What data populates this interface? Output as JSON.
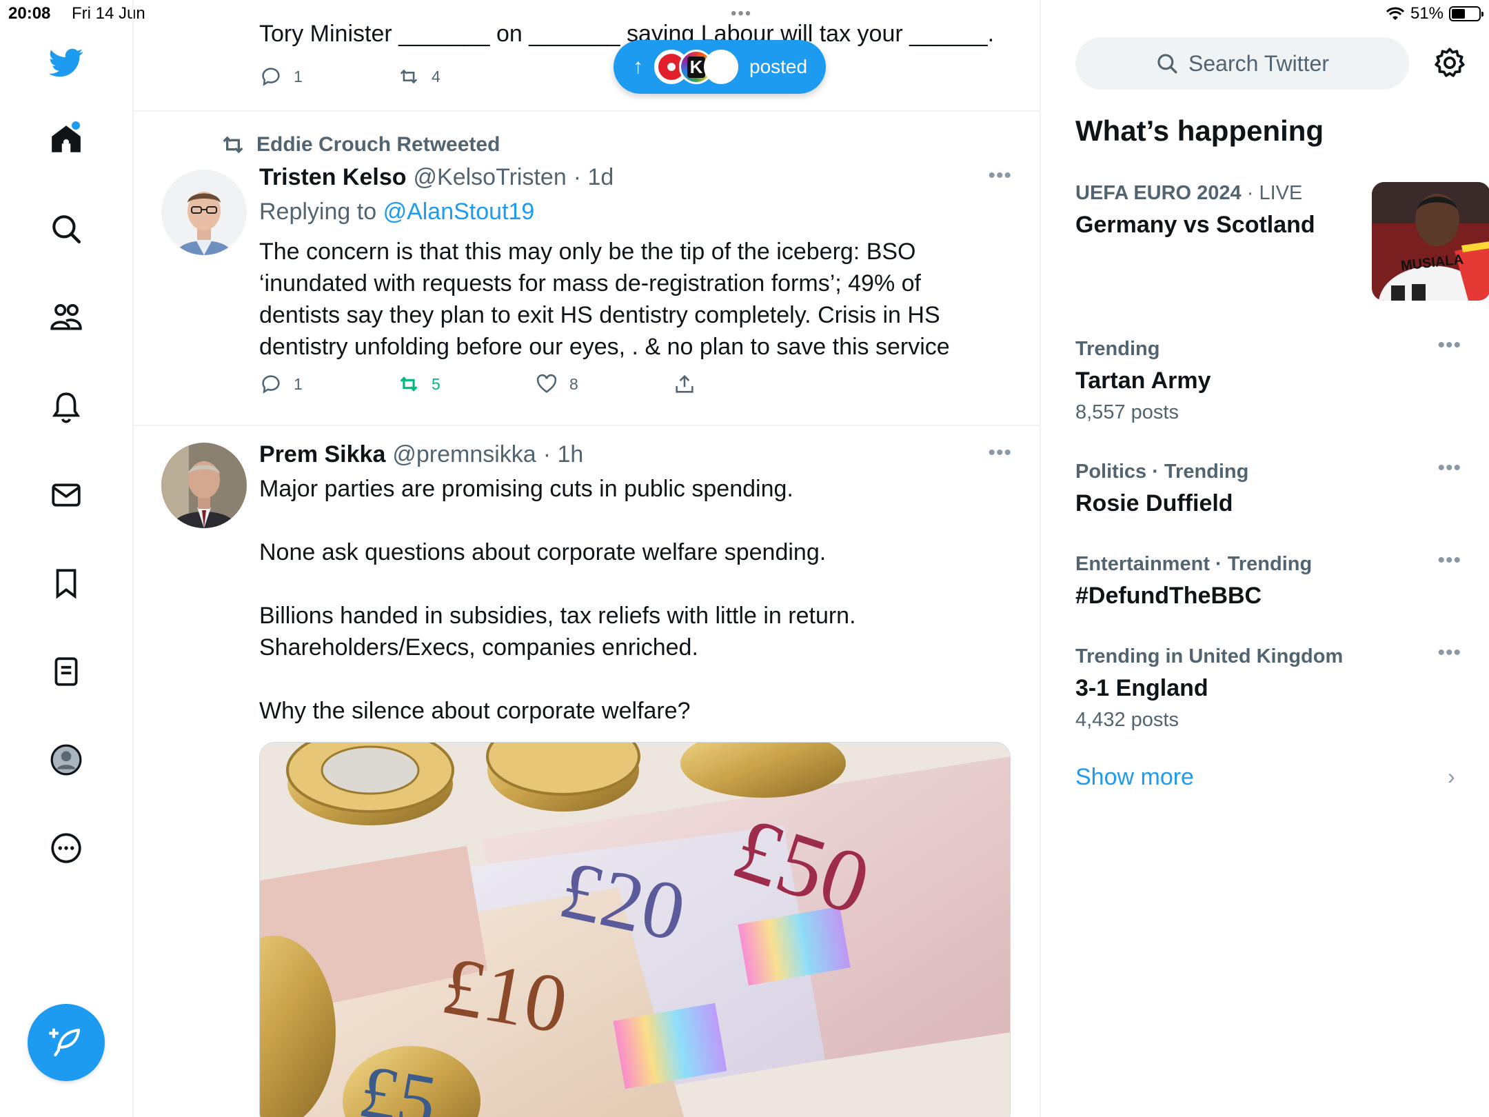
{
  "status_bar": {
    "time": "20:08",
    "date": "Fri 14 Jun",
    "battery": "51%",
    "battery_level": 0.51
  },
  "nav": {
    "items": [
      {
        "name": "twitter-logo-icon"
      },
      {
        "name": "home-icon"
      },
      {
        "name": "search-icon"
      },
      {
        "name": "communities-icon"
      },
      {
        "name": "notifications-bell-icon"
      },
      {
        "name": "messages-envelope-icon"
      },
      {
        "name": "bookmarks-icon"
      },
      {
        "name": "lists-icon"
      },
      {
        "name": "profile-avatar-icon"
      },
      {
        "name": "more-icon"
      }
    ],
    "compose": "compose-feather-icon"
  },
  "feed": {
    "top_tweet": {
      "text": "Tory Minister _______ on _______ saying Labour will tax your ______.",
      "replies": "1",
      "retweets": "4"
    },
    "posted_pill": {
      "label": "posted"
    },
    "tweet1": {
      "retweeted_by": "Eddie Crouch Retweeted",
      "name": "Tristen Kelso",
      "handle": "@KelsoTristen",
      "time": "· 1d",
      "replying_label": "Replying to",
      "replying_handle": "@AlanStout19",
      "text": "The concern is that this may only be the tip of the iceberg: BSO ‘inundated with requests for mass de-registration forms’; 49% of dentists say they plan to exit HS dentistry completely. Crisis in HS dentistry unfolding before our eyes, . & no plan to save this service",
      "replies": "1",
      "retweets": "5",
      "likes": "8"
    },
    "tweet2": {
      "name": "Prem Sikka",
      "handle": "@premnsikka",
      "time": "· 1h",
      "text": "Major parties are promising cuts in public spending.\n\nNone ask questions about corporate welfare spending.\n\nBillions handed in subsidies, tax reliefs with little in return. Shareholders/Execs, companies enriched.\n\nWhy the silence about corporate welfare?",
      "media_labels": [
        "£50",
        "£20",
        "£10",
        "£5"
      ]
    }
  },
  "sidebar": {
    "search_placeholder": "Search Twitter",
    "title": "What’s happening",
    "trends": [
      {
        "category": "UEFA EURO 2024",
        "live": "· LIVE",
        "title": "Germany vs Scotland",
        "count": "",
        "image_text": "MUSIALA"
      },
      {
        "category": "Trending",
        "title": "Tartan Army",
        "count": "8,557 posts"
      },
      {
        "category": "Politics · Trending",
        "title": "Rosie Duffield",
        "count": ""
      },
      {
        "category": "Entertainment · Trending",
        "title": "#DefundTheBBC",
        "count": ""
      },
      {
        "category": "Trending in United Kingdom",
        "title": "3-1 England",
        "count": "4,432 posts"
      }
    ],
    "show_more": "Show more"
  },
  "colors": {
    "accent": "#1d9bf0",
    "retweet_green": "#00ba7c",
    "muted": "#536471"
  }
}
